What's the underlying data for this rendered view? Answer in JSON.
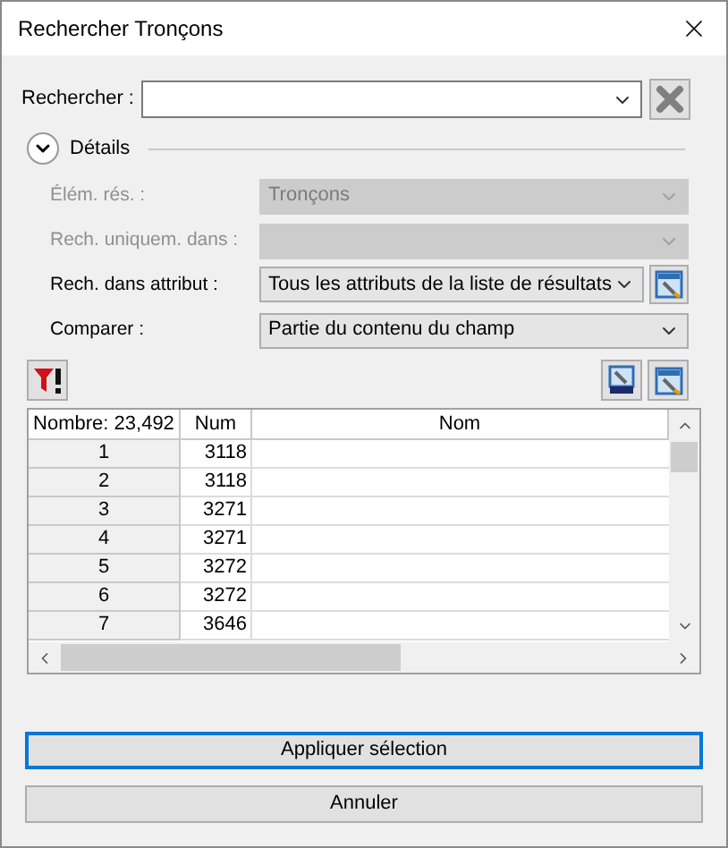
{
  "window": {
    "title": "Rechercher Tronçons"
  },
  "search": {
    "label": "Rechercher :"
  },
  "details": {
    "label": "Détails",
    "expanded": true
  },
  "fields": [
    {
      "kind": "dropdown",
      "label": "Élém. rés. :",
      "value": "Tronçons",
      "disabled": true
    },
    {
      "kind": "dropdown",
      "label": "Rech. uniquem. dans :",
      "disabled": true
    },
    {
      "kind": "dropdown_button",
      "label": "Rech. dans attribut :",
      "value": "Tous les attributs de la liste de résultats",
      "disabled": false
    },
    {
      "kind": "dropdown",
      "label": "Comparer :",
      "value": "Partie du contenu du champ",
      "disabled": false
    }
  ],
  "table": {
    "columns": [
      "Nombre: 23,492",
      "Num",
      "Nom"
    ],
    "rows": [
      {
        "index": "1",
        "num": "3118"
      },
      {
        "index": "2",
        "num": "3118"
      },
      {
        "index": "3",
        "num": "3271"
      },
      {
        "index": "4",
        "num": "3271"
      },
      {
        "index": "5",
        "num": "3272"
      },
      {
        "index": "6",
        "num": "3272"
      },
      {
        "index": "7",
        "num": "3646"
      }
    ]
  },
  "buttons": [
    {
      "label": "Appliquer sélection",
      "default": true
    },
    {
      "label": "Annuler",
      "default": false
    }
  ]
}
